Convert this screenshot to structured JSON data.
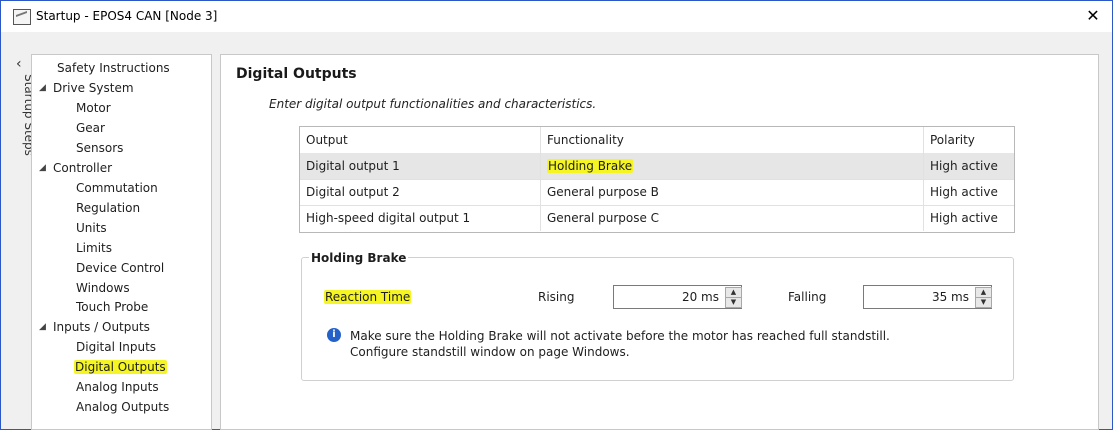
{
  "window": {
    "title": "Startup - EPOS4 CAN [Node 3]"
  },
  "side": {
    "label": "Startup Steps"
  },
  "nav": {
    "safety": "Safety Instructions",
    "drive_system": "Drive System",
    "motor": "Motor",
    "gear": "Gear",
    "sensors": "Sensors",
    "controller": "Controller",
    "commutation": "Commutation",
    "regulation": "Regulation",
    "units": "Units",
    "limits": "Limits",
    "device_control": "Device Control",
    "windows": "Windows",
    "touch_probe": "Touch Probe",
    "inputs_outputs": "Inputs / Outputs",
    "digital_inputs": "Digital Inputs",
    "digital_outputs": "Digital Outputs",
    "analog_inputs": "Analog Inputs",
    "analog_outputs": "Analog Outputs",
    "selected": "Digital Outputs"
  },
  "page": {
    "heading": "Digital Outputs",
    "subtitle": "Enter digital output functionalities and characteristics."
  },
  "table": {
    "headers": {
      "output": "Output",
      "functionality": "Functionality",
      "polarity": "Polarity"
    },
    "rows": [
      {
        "output": "Digital output 1",
        "functionality": "Holding Brake",
        "polarity": "High active"
      },
      {
        "output": "Digital output 2",
        "functionality": "General purpose B",
        "polarity": "High active"
      },
      {
        "output": "High-speed digital output 1",
        "functionality": "General purpose C",
        "polarity": "High active"
      }
    ]
  },
  "brake": {
    "title": "Holding Brake",
    "reaction_label": "Reaction Time",
    "rising_label": "Rising",
    "rising_value": "20 ms",
    "falling_label": "Falling",
    "falling_value": "35 ms",
    "info_line1": "Make sure the Holding Brake will not activate before the motor has reached full standstill.",
    "info_line2": "Configure standstill window on page Windows."
  },
  "colors": {
    "highlight": "#f5f523",
    "accent": "#2462c9",
    "window_border": "#2c57c7"
  }
}
